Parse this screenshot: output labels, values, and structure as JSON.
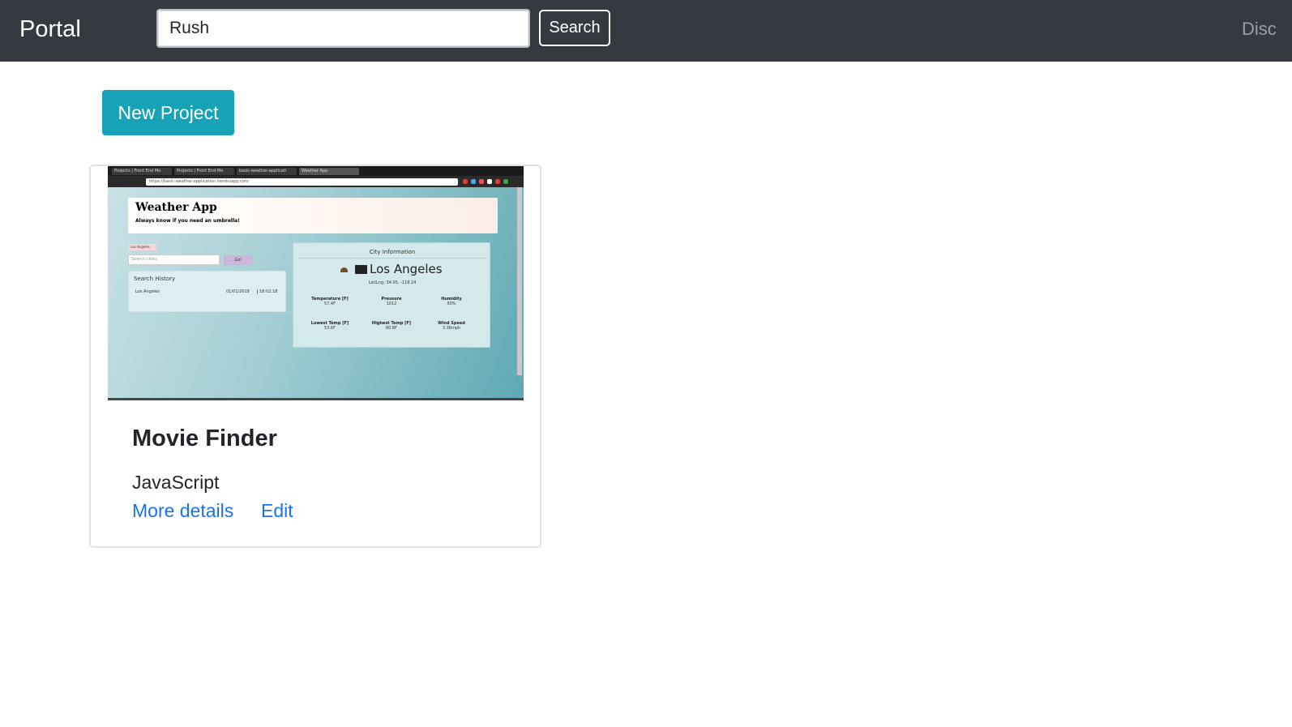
{
  "navbar": {
    "brand": "Portal",
    "search_value": "Rush",
    "search_button": "Search",
    "right_link": "Disc"
  },
  "main": {
    "new_project_label": "New Project"
  },
  "card": {
    "title": "Movie Finder",
    "language": "JavaScript",
    "details_link": "More details",
    "edit_link": "Edit",
    "thumbnail": {
      "tabs": [
        "Projects | Front End Mo",
        "Projects | Front End Mo",
        "basic-weather-applicati",
        "Weather App"
      ],
      "url": "https://basic-weather-application.herokuapp.com",
      "app_title": "Weather App",
      "app_subtitle": "Always know if you need an umbrella!",
      "chip": "Los Angeles",
      "search_placeholder": "Search cities",
      "go_label": "Go!",
      "history_title": "Search History",
      "history_city": "Los Angeles",
      "history_date": "01/01/2018",
      "history_time": "18:02:18",
      "city_info_title": "City Information",
      "city_name": "Los Angeles",
      "latlng": "Lat/Lng: 34.05, -118.24",
      "stats": [
        {
          "label": "Temperature [F]",
          "value": "57.4F"
        },
        {
          "label": "Pressure",
          "value": "1012"
        },
        {
          "label": "Humidity",
          "value": "50%"
        },
        {
          "label": "Lowest Temp [F]",
          "value": "53.6F"
        },
        {
          "label": "Highest Temp [F]",
          "value": "60.8F"
        },
        {
          "label": "Wind Speed",
          "value": "3.36mph"
        }
      ]
    }
  },
  "colors": {
    "navbar_bg": "#343a40",
    "new_project_bg": "#17a2b8",
    "link": "#1a73e8"
  }
}
